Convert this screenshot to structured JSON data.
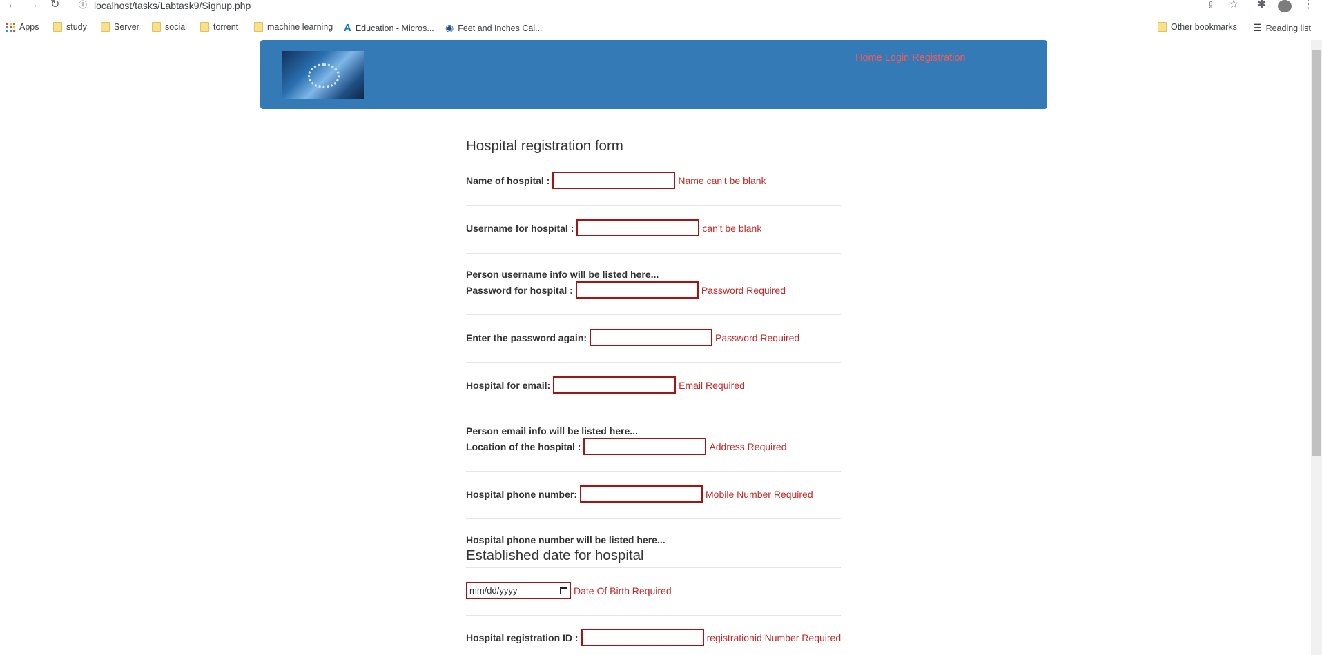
{
  "browser": {
    "url": "localhost/tasks/Labtask9/Signup.php",
    "bookmarks": [
      "Apps",
      "study",
      "Server",
      "social",
      "torrent",
      "machine learning",
      "Education - Micros...",
      "Feet and Inches Cal..."
    ],
    "other_bookmarks": "Other bookmarks",
    "reading_list": "Reading list"
  },
  "header": {
    "nav": [
      "Home",
      "Login",
      "Registration"
    ]
  },
  "form": {
    "title": "Hospital registration form",
    "fields": {
      "name": {
        "label": "Name of hospital :",
        "error": "Name can't be blank"
      },
      "username": {
        "label": "Username for hospital :",
        "error": "can't be blank",
        "info": "Person username info will be listed here..."
      },
      "password": {
        "label": "Password for hospital :",
        "error": "Password Required"
      },
      "password2": {
        "label": "Enter the password again:",
        "error": "Password Required"
      },
      "email": {
        "label": "Hospital for email:",
        "error": "Email Required",
        "info": "Person email info will be listed here..."
      },
      "location": {
        "label": "Location of the hospital :",
        "error": "Address Required"
      },
      "phone": {
        "label": "Hospital phone number:",
        "error": "Mobile Number Required",
        "info": "Hospital phone number will be listed here..."
      },
      "date": {
        "placeholder": "mm/dd/yyyy",
        "error": "Date Of Birth Required"
      },
      "regid": {
        "label": "Hospital registration ID :",
        "error": "registrationid Number Required"
      }
    },
    "established_title": "Established date for hospital"
  },
  "colors": {
    "header_bg": "#337ab7",
    "nav_link": "#f05c5c",
    "error": "#c62828",
    "input_border": "#a31515"
  }
}
